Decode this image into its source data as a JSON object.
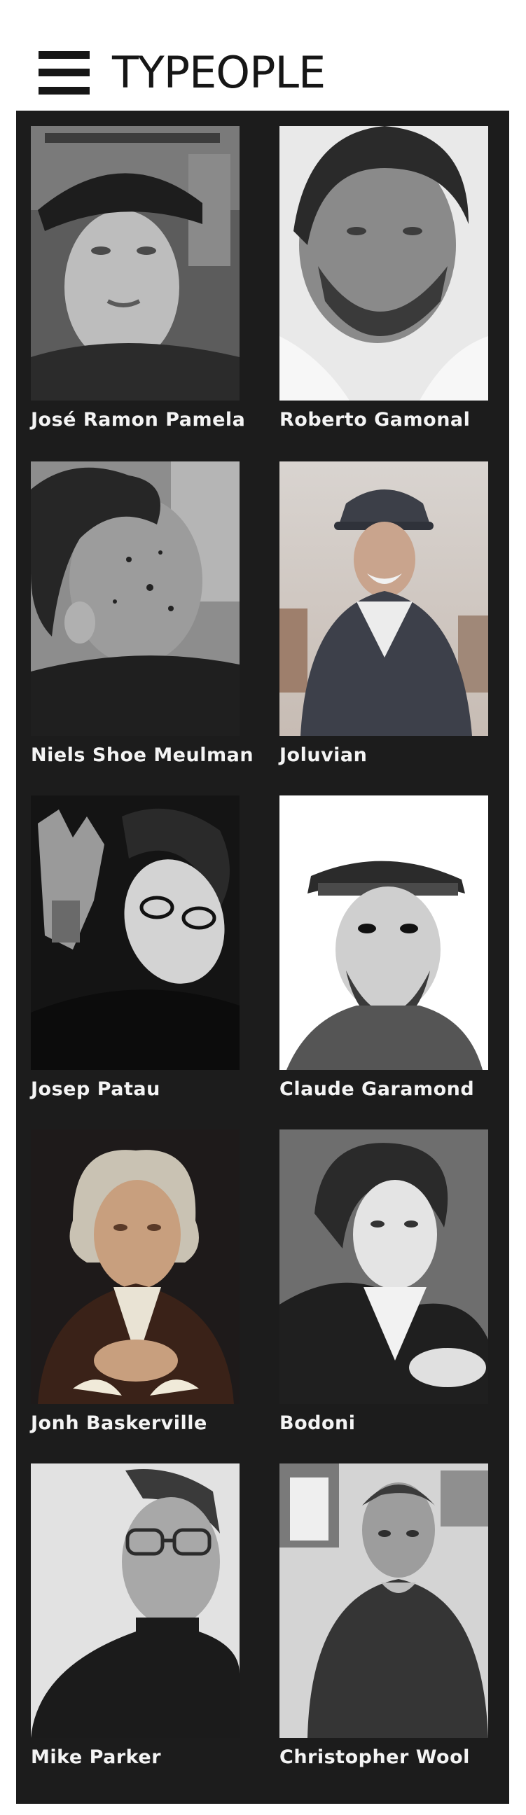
{
  "site": {
    "title": "TYPEOPLE"
  },
  "people": [
    {
      "name": "José Ramon Pamela"
    },
    {
      "name": "Roberto Gamonal"
    },
    {
      "name": "Niels Shoe Meulman"
    },
    {
      "name": "Joluvian"
    },
    {
      "name": "Josep Patau"
    },
    {
      "name": "Claude Garamond"
    },
    {
      "name": "Jonh Baskerville"
    },
    {
      "name": "Bodoni"
    },
    {
      "name": "Mike Parker"
    },
    {
      "name": "Christopher Wool"
    }
  ],
  "colors": {
    "panel_background": "#1c1c1c",
    "header_text": "#161616",
    "name_text": "#f4f4f4"
  }
}
